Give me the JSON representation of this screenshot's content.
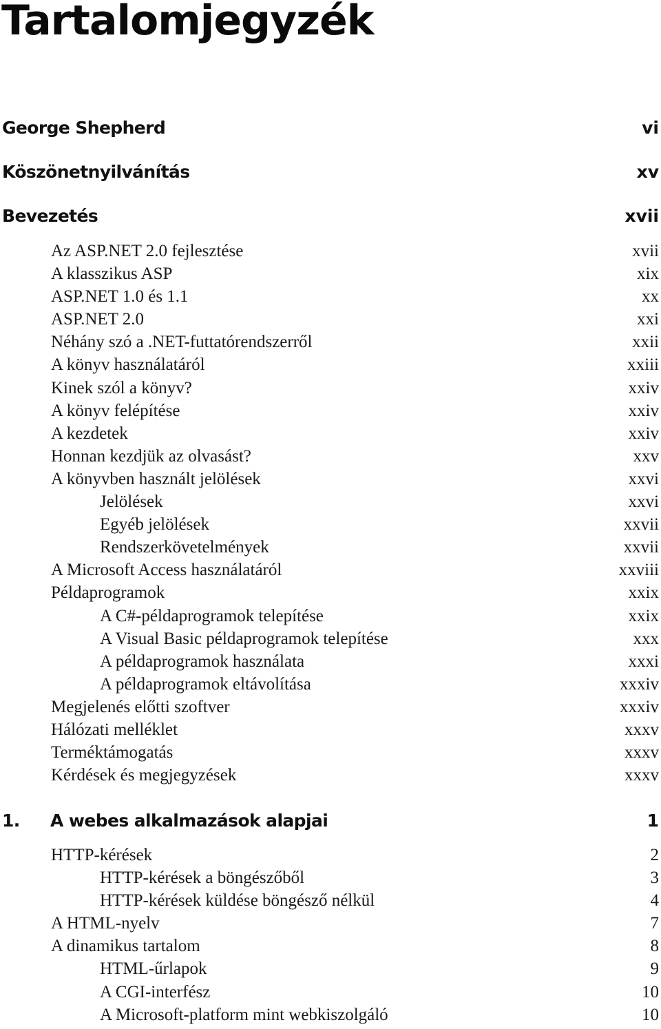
{
  "title": "Tartalomjegyzék",
  "front_matter": [
    {
      "label": "George Shepherd",
      "page": "vi"
    },
    {
      "label": "Köszönetnyilvánítás",
      "page": "xv"
    },
    {
      "label": "Bevezetés",
      "page": "xvii"
    }
  ],
  "intro_entries": [
    {
      "level": 1,
      "label": "Az ASP.NET 2.0 fejlesztése",
      "page": "xvii"
    },
    {
      "level": 1,
      "label": "A klasszikus ASP",
      "page": "xix"
    },
    {
      "level": 1,
      "label": "ASP.NET 1.0 és 1.1",
      "page": "xx"
    },
    {
      "level": 1,
      "label": "ASP.NET 2.0",
      "page": "xxi"
    },
    {
      "level": 1,
      "label": "Néhány szó a .NET-futtatórendszerről",
      "page": "xxii"
    },
    {
      "level": 1,
      "label": "A könyv használatáról",
      "page": "xxiii"
    },
    {
      "level": 1,
      "label": "Kinek szól a könyv?",
      "page": "xxiv"
    },
    {
      "level": 1,
      "label": "A könyv felépítése",
      "page": "xxiv"
    },
    {
      "level": 1,
      "label": "A kezdetek",
      "page": "xxiv"
    },
    {
      "level": 1,
      "label": "Honnan kezdjük az olvasást?",
      "page": "xxv"
    },
    {
      "level": 1,
      "label": "A könyvben használt jelölések",
      "page": "xxvi"
    },
    {
      "level": 2,
      "label": "Jelölések",
      "page": "xxvi"
    },
    {
      "level": 2,
      "label": "Egyéb jelölések",
      "page": "xxvii"
    },
    {
      "level": 2,
      "label": "Rendszerkövetelmények",
      "page": "xxvii"
    },
    {
      "level": 1,
      "label": "A Microsoft Access használatáról",
      "page": "xxviii"
    },
    {
      "level": 1,
      "label": "Példaprogramok",
      "page": "xxix"
    },
    {
      "level": 2,
      "label": "A C#-példaprogramok telepítése",
      "page": "xxix"
    },
    {
      "level": 2,
      "label": "A Visual Basic példaprogramok telepítése",
      "page": "xxx"
    },
    {
      "level": 2,
      "label": "A példaprogramok használata",
      "page": "xxxi"
    },
    {
      "level": 2,
      "label": "A példaprogramok eltávolítása",
      "page": "xxxiv"
    },
    {
      "level": 1,
      "label": "Megjelenés előtti szoftver",
      "page": "xxxiv"
    },
    {
      "level": 1,
      "label": "Hálózati melléklet",
      "page": "xxxv"
    },
    {
      "level": 1,
      "label": "Terméktámogatás",
      "page": "xxxv"
    },
    {
      "level": 1,
      "label": "Kérdések és megjegyzések",
      "page": "xxxv"
    }
  ],
  "chapter1": {
    "number": "1.",
    "label": "A webes alkalmazások alapjai",
    "page": "1",
    "entries": [
      {
        "level": 1,
        "label": "HTTP-kérések",
        "page": "2"
      },
      {
        "level": 2,
        "label": "HTTP-kérések a böngészőből",
        "page": "3"
      },
      {
        "level": 2,
        "label": "HTTP-kérések küldése böngésző nélkül",
        "page": "4"
      },
      {
        "level": 1,
        "label": "A HTML-nyelv",
        "page": "7"
      },
      {
        "level": 1,
        "label": "A dinamikus tartalom",
        "page": "8"
      },
      {
        "level": 2,
        "label": "HTML-űrlapok",
        "page": "9"
      },
      {
        "level": 2,
        "label": "A CGI-interfész",
        "page": "10"
      },
      {
        "level": 2,
        "label": "A Microsoft-platform mint webkiszolgáló",
        "page": "10"
      }
    ]
  }
}
